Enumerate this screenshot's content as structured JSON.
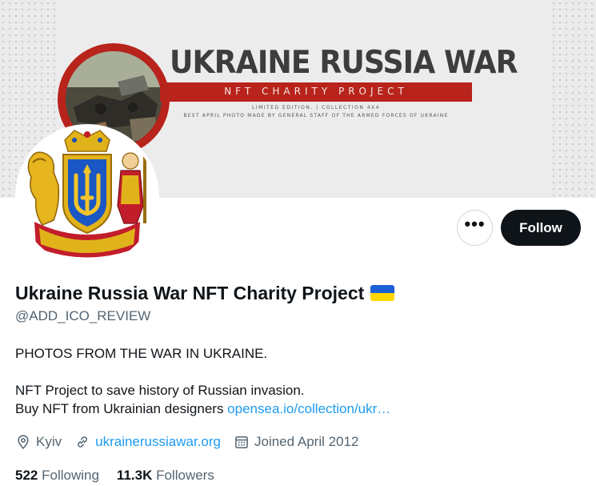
{
  "banner": {
    "title": "UKRAINE RUSSIA WAR",
    "subtitle": "NFT CHARITY PROJECT",
    "line1": "LIMITED EDITION. | COLLECTION 4X4",
    "line2": "BEST APRIL PHOTO MADE BY GENERAL STAFF OF THE ARMED FORCES OF UKRAINE",
    "accent_color": "#b8231b"
  },
  "profile": {
    "display_name": "Ukraine Russia War NFT Charity Project",
    "handle": "@ADD_ICO_REVIEW",
    "flag_icon": "ukraine-flag-icon",
    "bio": {
      "line1": "PHOTOS FROM THE WAR IN UKRAINE.",
      "line2": "NFT Project to save history of Russian invasion.",
      "line3_text": "Buy NFT from Ukrainian designers ",
      "line3_link": "opensea.io/collection/ukr…"
    },
    "location": "Kyiv",
    "website": "ukrainerussiawar.org",
    "joined": "Joined April 2012"
  },
  "actions": {
    "more_icon": "more-dots-icon",
    "more_label": "•••",
    "follow_label": "Follow"
  },
  "stats": {
    "following_count": "522",
    "following_label": "Following",
    "followers_count": "11.3K",
    "followers_label": "Followers"
  },
  "colors": {
    "link": "#1d9bf0",
    "secondary_text": "#536471",
    "primary_text": "#0f1419",
    "follow_bg": "#0f1419"
  }
}
